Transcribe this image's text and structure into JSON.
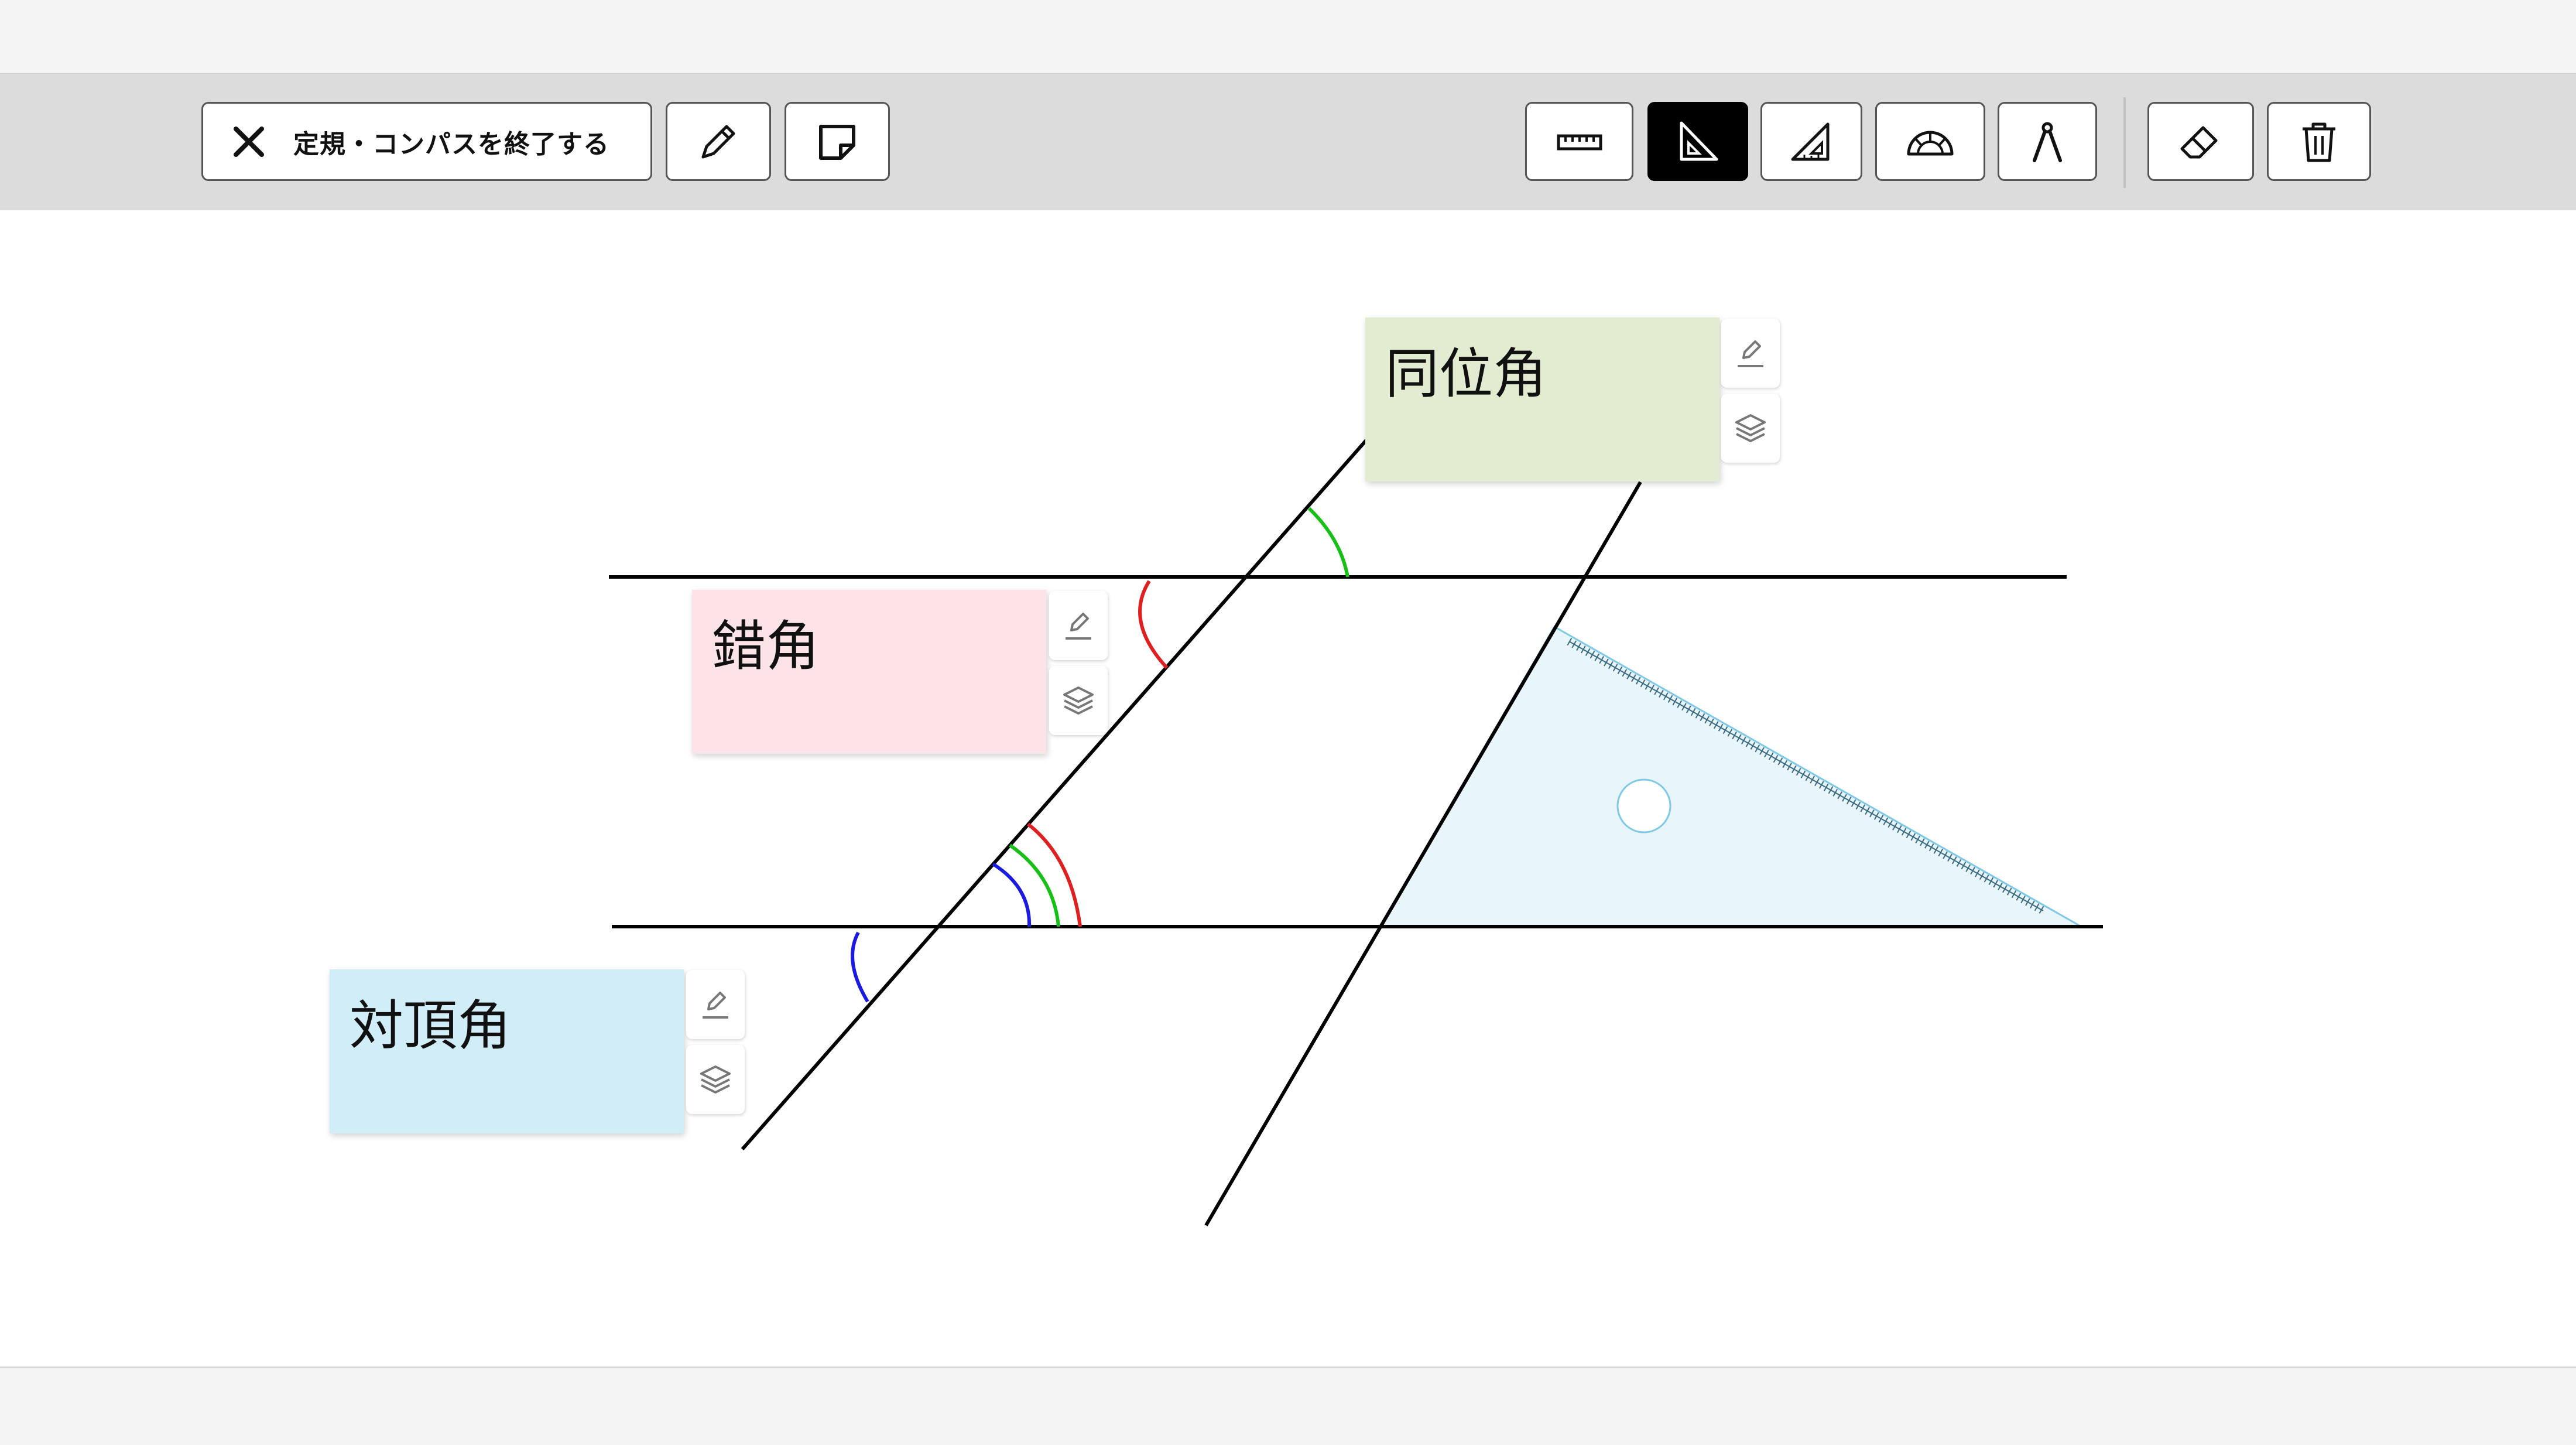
{
  "toolbar": {
    "exit_label": "定規・コンパスを終了する",
    "exit_icon": "close-icon",
    "left_tools": [
      "pencil-icon",
      "sticky-note-icon"
    ],
    "right_tools": [
      "ruler-icon",
      "set-square-45-icon",
      "set-square-30-60-icon",
      "protractor-icon",
      "compass-icon"
    ],
    "active_tool": "set-square-45-icon",
    "edit_tools": [
      "eraser-icon",
      "trash-icon"
    ]
  },
  "notes": [
    {
      "id": "corresponding",
      "label": "同位角",
      "color": "#e2ecd0"
    },
    {
      "id": "alternate",
      "label": "錯角",
      "color": "#fbe3e8"
    },
    {
      "id": "vertical",
      "label": "対頂角",
      "color": "#d0edf8"
    }
  ],
  "note_tools": [
    "edit-pen-icon",
    "layers-icon"
  ],
  "colors": {
    "toolbar_bg": "#dcdcdc",
    "active_button": "#000000",
    "angle_red": "#e02020",
    "angle_green": "#16c016",
    "angle_blue": "#1a1ae0",
    "set_square_fill": "#e8f5fb",
    "set_square_stroke": "#7fc8e6"
  }
}
